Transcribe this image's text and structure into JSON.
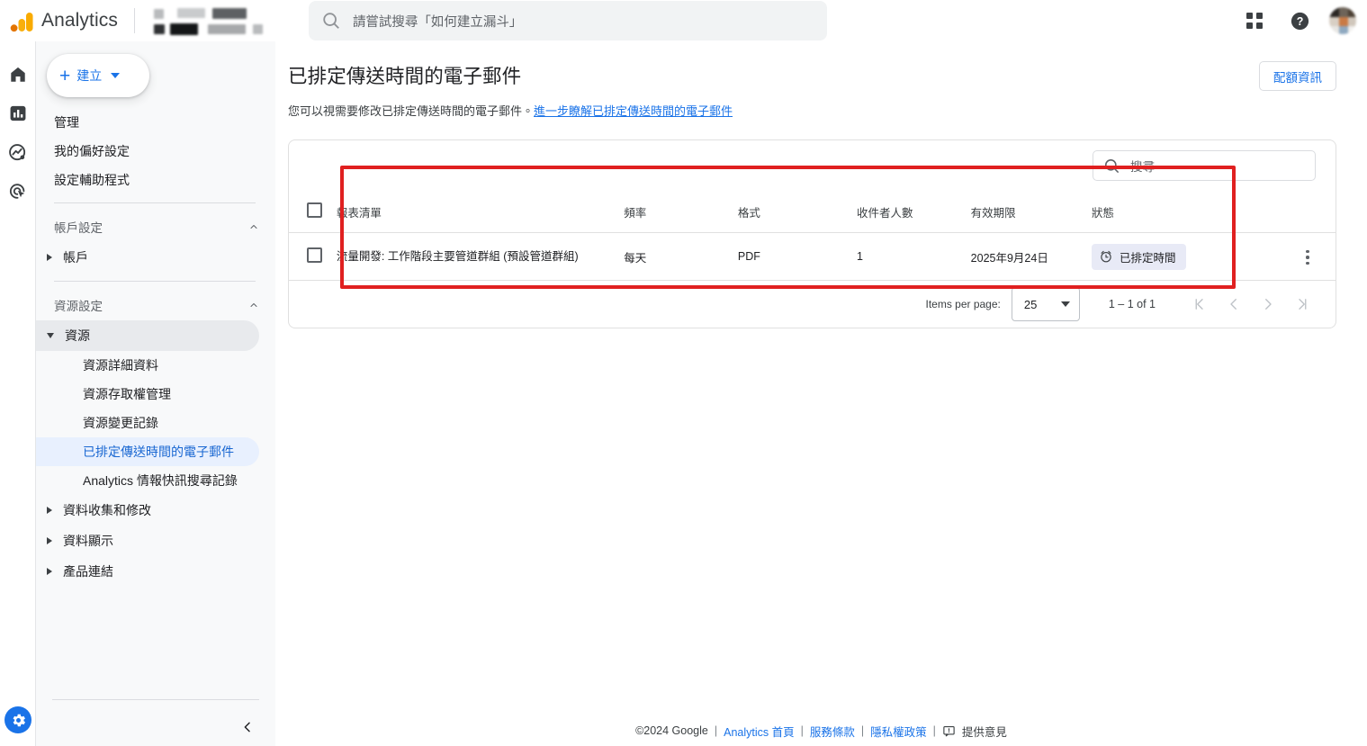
{
  "topbar": {
    "brand": "Analytics",
    "property_selector_blurred": true,
    "search_placeholder": "請嘗試搜尋「如何建立漏斗」",
    "apps_icon": "apps-grid-icon",
    "help_icon": "help-circle-icon",
    "avatar_icon": "account-avatar"
  },
  "rail": {
    "items": [
      {
        "name": "home",
        "icon": "home-icon",
        "selected": false
      },
      {
        "name": "reports",
        "icon": "bar-chart-icon",
        "selected": true
      },
      {
        "name": "explore",
        "icon": "explore-trending-icon",
        "selected": false
      },
      {
        "name": "advertising",
        "icon": "target-cursor-icon",
        "selected": false
      }
    ],
    "admin": {
      "name": "admin",
      "icon": "gear-icon",
      "selected": true
    }
  },
  "sidebar": {
    "create_button": {
      "label": "建立",
      "plus_icon": "plus-icon",
      "caret_icon": "chevron-down-icon"
    },
    "links": [
      "管理",
      "我的偏好設定",
      "設定輔助程式"
    ],
    "sections": [
      {
        "title": "帳戶設定",
        "collapse_icon": "chevron-up-icon",
        "groups": [
          {
            "label": "帳戶",
            "expanded": false,
            "children": []
          }
        ]
      },
      {
        "title": "資源設定",
        "collapse_icon": "chevron-up-icon",
        "groups": [
          {
            "label": "資源",
            "expanded": true,
            "children": [
              {
                "label": "資源詳細資料",
                "active": false
              },
              {
                "label": "資源存取權管理",
                "active": false
              },
              {
                "label": "資源變更記錄",
                "active": false
              },
              {
                "label": "已排定傳送時間的電子郵件",
                "active": true
              },
              {
                "label": "Analytics 情報快訊搜尋記錄",
                "active": false
              }
            ]
          },
          {
            "label": "資料收集和修改",
            "expanded": false,
            "children": []
          },
          {
            "label": "資料顯示",
            "expanded": false,
            "children": []
          },
          {
            "label": "產品連結",
            "expanded": false,
            "children": []
          }
        ]
      }
    ],
    "collapse_icon": "chevron-left-icon"
  },
  "page": {
    "title": "已排定傳送時間的電子郵件",
    "description_prefix": "您可以視需要修改已排定傳送時間的電子郵件。",
    "description_link": "進一步瞭解已排定傳送時間的電子郵件",
    "quota_button": "配額資訊"
  },
  "table": {
    "search_placeholder": "搜尋",
    "search_icon": "search-icon",
    "columns": [
      "報表清單",
      "頻率",
      "格式",
      "收件者人數",
      "有效期限",
      "狀態"
    ],
    "rows": [
      {
        "name": "流量開發: 工作階段主要管道群組 (預設管道群組)",
        "frequency": "每天",
        "format": "PDF",
        "recipients": "1",
        "expiry": "2025年9月24日",
        "status": "已排定時間",
        "status_icon": "alarm-clock-icon",
        "menu_icon": "more-vert-icon",
        "selected": false
      }
    ],
    "paginator": {
      "items_per_page_label": "Items per page:",
      "items_per_page_value": "25",
      "range_label": "1 – 1 of 1",
      "first_icon": "first-page-icon",
      "prev_icon": "prev-page-icon",
      "next_icon": "next-page-icon",
      "last_icon": "last-page-icon"
    }
  },
  "highlight": {
    "color": "#e02020",
    "target": "reports-table"
  },
  "footer": {
    "copyright": "©2024 Google",
    "links": [
      "Analytics 首頁",
      "服務條款",
      "隱私權政策"
    ],
    "feedback": "提供意見",
    "feedback_icon": "feedback-icon",
    "separator": "|"
  },
  "colors": {
    "accent_blue": "#1a73e8",
    "active_nav_bg": "#e8f0fe",
    "active_nav_text": "#1967d2",
    "chip_bg": "#e8eaf6",
    "highlight_red": "#e02020",
    "logo_orange": "#f9ab00"
  }
}
